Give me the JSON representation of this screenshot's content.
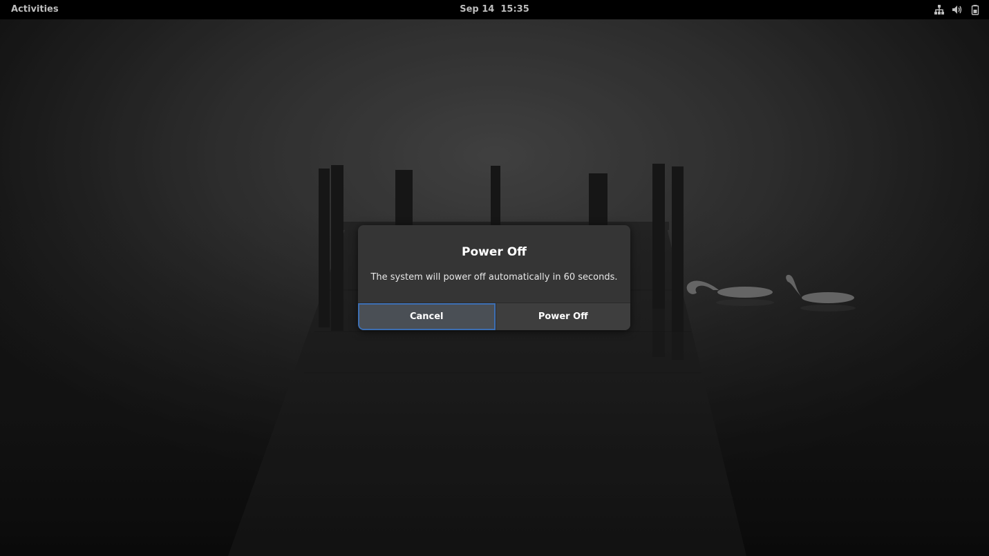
{
  "top_bar": {
    "activities_label": "Activities",
    "clock_text": "Sep 14  15:35",
    "tray_icons": [
      "network-icon",
      "volume-icon",
      "battery-icon"
    ]
  },
  "dialog": {
    "title": "Power Off",
    "message": "The system will power off automatically in 60 seconds.",
    "cancel_label": "Cancel",
    "confirm_label": "Power Off"
  },
  "colors": {
    "top_bar_bg": "#000000",
    "dialog_bg": "#353535",
    "focus_ring": "#3d6fb3"
  }
}
